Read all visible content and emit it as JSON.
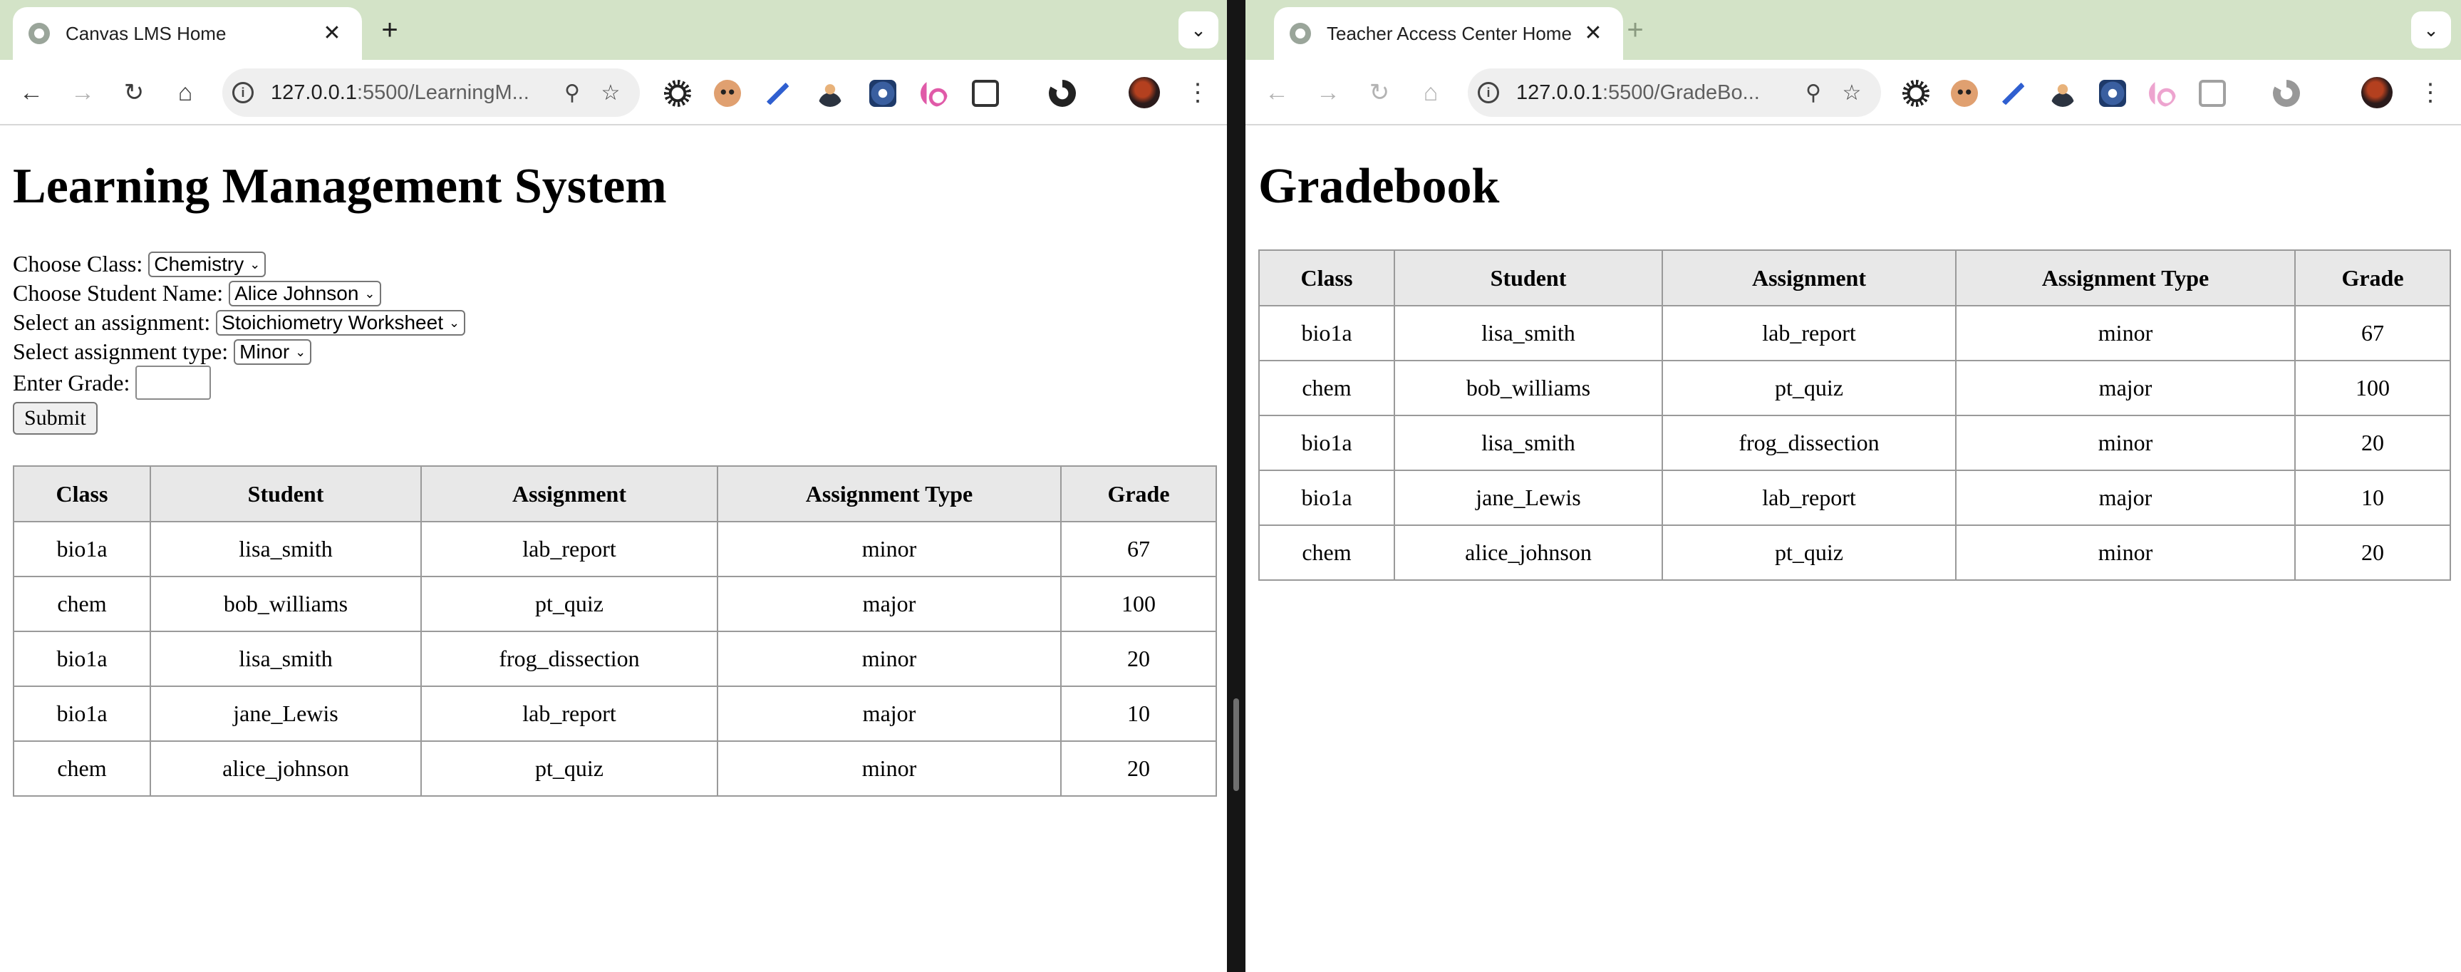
{
  "left": {
    "tab_title": "Canvas LMS Home",
    "url_host": "127.0.0.1",
    "url_rest": ":5500/LearningM...",
    "page_title": "Learning Management System",
    "form": {
      "class_label": "Choose Class:",
      "class_value": "Chemistry",
      "student_label": "Choose Student Name:",
      "student_value": "Alice Johnson",
      "assignment_label": "Select an assignment:",
      "assignment_value": "Stoichiometry Worksheet",
      "type_label": "Select assignment type:",
      "type_value": "Minor",
      "grade_label": "Enter Grade:",
      "grade_value": "",
      "submit_label": "Submit"
    }
  },
  "right": {
    "tab_title": "Teacher Access Center Home",
    "url_host": "127.0.0.1",
    "url_rest": ":5500/GradeBo...",
    "page_title": "Gradebook"
  },
  "table": {
    "headers": [
      "Class",
      "Student",
      "Assignment",
      "Assignment Type",
      "Grade"
    ],
    "rows": [
      [
        "bio1a",
        "lisa_smith",
        "lab_report",
        "minor",
        "67"
      ],
      [
        "chem",
        "bob_williams",
        "pt_quiz",
        "major",
        "100"
      ],
      [
        "bio1a",
        "lisa_smith",
        "frog_dissection",
        "minor",
        "20"
      ],
      [
        "bio1a",
        "jane_Lewis",
        "lab_report",
        "major",
        "10"
      ],
      [
        "chem",
        "alice_johnson",
        "pt_quiz",
        "minor",
        "20"
      ]
    ]
  },
  "icons": {
    "close": "✕",
    "new_tab": "+",
    "tab_menu": "⌄",
    "back": "←",
    "forward": "→",
    "reload": "↻",
    "home": "⌂",
    "zoom": "⚲",
    "bookmark": "☆",
    "menu": "⋮"
  },
  "colors": {
    "tabstrip": "#d3e3c7",
    "table_header": "#e8e8e8",
    "omnibox": "#efefef"
  }
}
